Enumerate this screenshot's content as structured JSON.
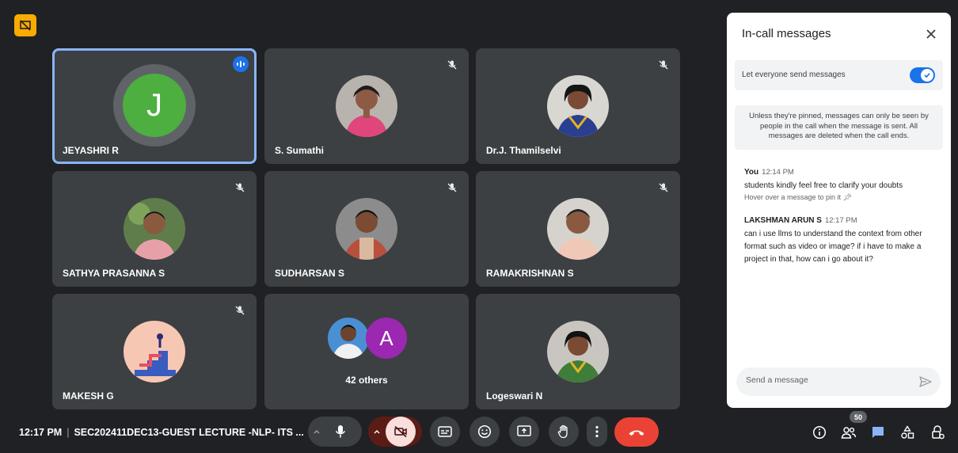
{
  "participants": [
    {
      "name": "JEYASHRI R",
      "initial": "J",
      "state": "speaking"
    },
    {
      "name": "S. Sumathi",
      "state": "muted"
    },
    {
      "name": "Dr.J. Thamilselvi",
      "state": "muted"
    },
    {
      "name": "SATHYA PRASANNA S",
      "state": "muted"
    },
    {
      "name": "SUDHARSAN S",
      "state": "muted"
    },
    {
      "name": "RAMAKRISHNAN S",
      "state": "muted"
    },
    {
      "name": "MAKESH G",
      "state": "muted"
    },
    {
      "name": "Logeswari N",
      "state": "unmuted"
    }
  ],
  "others": {
    "label": "42 others",
    "avatar_initial": "A"
  },
  "chat_panel": {
    "title": "In-call messages",
    "toggle_label": "Let everyone send messages",
    "toggle_on": true,
    "info": "Unless they're pinned, messages can only be seen by people in the call when the message is sent. All messages are deleted when the call ends.",
    "messages": [
      {
        "sender": "You",
        "time": "12:14 PM",
        "text": "students kindly feel free to clarify your doubts",
        "hint": "Hover over a message to pin it"
      },
      {
        "sender": "LAKSHMAN ARUN S",
        "time": "12:17 PM",
        "text": "can i use llms to understand the context from other format such as video or image? if i have to make a project in that, how can i go about it?"
      }
    ],
    "input_placeholder": "Send a message"
  },
  "bottom_bar": {
    "time": "12:17 PM",
    "meeting_title": "SEC202411DEC13-GUEST LECTURE -NLP- ITS ...",
    "participant_count": "50"
  },
  "colors": {
    "accent": "#1a73e8",
    "end_call": "#ea4335",
    "tile": "#3c4043",
    "background": "#202124"
  }
}
